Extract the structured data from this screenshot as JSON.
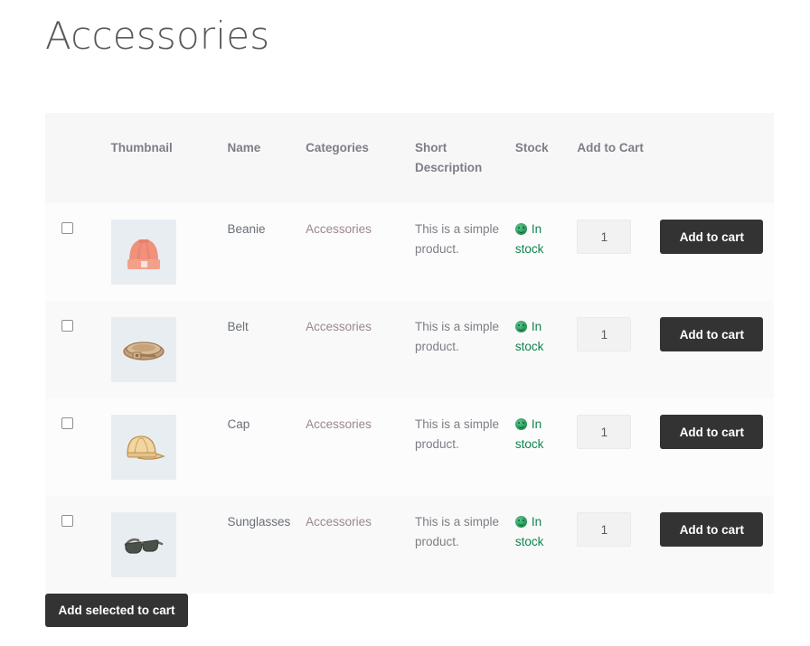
{
  "page": {
    "title": "Accessories"
  },
  "table": {
    "columns": [
      {
        "key": "check",
        "label": ""
      },
      {
        "key": "thumbnail",
        "label": "Thumbnail"
      },
      {
        "key": "name",
        "label": "Name"
      },
      {
        "key": "categories",
        "label": "Categories"
      },
      {
        "key": "short_description",
        "label": "Short Description"
      },
      {
        "key": "stock",
        "label": "Stock"
      },
      {
        "key": "add_to_cart",
        "label": "Add to Cart"
      }
    ],
    "rows": [
      {
        "name": "Beanie",
        "category": "Accessories",
        "short_description": "This is a simple product.",
        "stock": "In stock",
        "stock_icon": "green-smiley-icon",
        "quantity": "1",
        "add_to_cart_label": "Add to cart",
        "thumbnail_icon": "beanie-thumbnail"
      },
      {
        "name": "Belt",
        "category": "Accessories",
        "short_description": "This is a simple product.",
        "stock": "In stock",
        "stock_icon": "green-smiley-icon",
        "quantity": "1",
        "add_to_cart_label": "Add to cart",
        "thumbnail_icon": "belt-thumbnail"
      },
      {
        "name": "Cap",
        "category": "Accessories",
        "short_description": "This is a simple product.",
        "stock": "In stock",
        "stock_icon": "green-smiley-icon",
        "quantity": "1",
        "add_to_cart_label": "Add to cart",
        "thumbnail_icon": "cap-thumbnail"
      },
      {
        "name": "Sunglasses",
        "category": "Accessories",
        "short_description": "This is a simple product.",
        "stock": "In stock",
        "stock_icon": "green-smiley-icon",
        "quantity": "1",
        "add_to_cart_label": "Add to cart",
        "thumbnail_icon": "sunglasses-thumbnail"
      }
    ]
  },
  "footer": {
    "add_selected_label": "Add selected to cart"
  },
  "colors": {
    "button_dark": "#333333",
    "header_bg": "#f7f7f7",
    "link": "#9c8691",
    "stock_green": "#0f834d",
    "thumbnail_bg": "#e8edf1",
    "title_text": "#5a5a5a"
  }
}
